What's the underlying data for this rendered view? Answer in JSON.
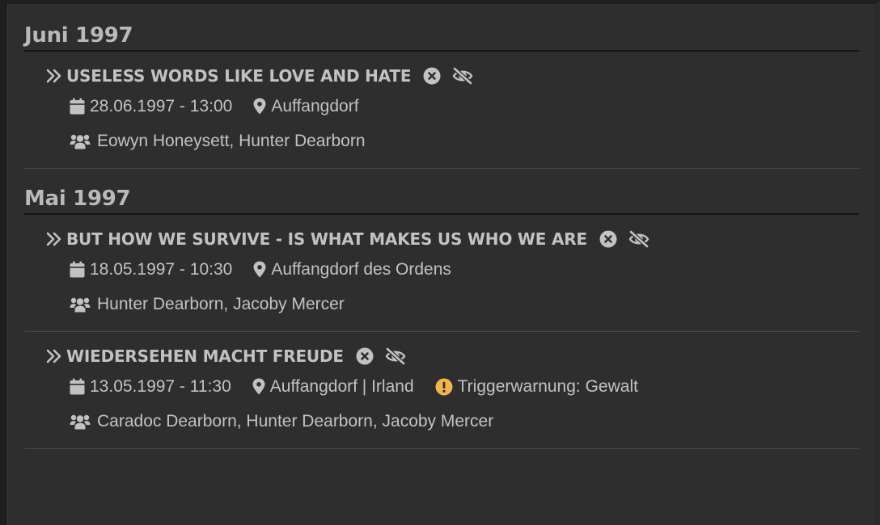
{
  "sections": [
    {
      "month": "Juni 1997",
      "events": [
        {
          "title": "USELESS WORDS LIKE LOVE AND HATE",
          "datetime": "28.06.1997 - 13:00",
          "location": "Auffangdorf",
          "participants": "Eowyn Honeysett, Hunter Dearborn"
        }
      ]
    },
    {
      "month": "Mai 1997",
      "events": [
        {
          "title": "BUT HOW WE SURVIVE - IS WHAT MAKES US WHO WE ARE",
          "datetime": "18.05.1997 - 10:30",
          "location": "Auffangdorf des Ordens",
          "participants": "Hunter Dearborn, Jacoby Mercer"
        },
        {
          "title": "WIEDERSEHEN MACHT FREUDE",
          "datetime": "13.05.1997 - 11:30",
          "location": "Auffangdorf | Irland",
          "warning": "Triggerwarnung: Gewalt",
          "participants": "Caradoc Dearborn, Hunter Dearborn, Jacoby Mercer"
        }
      ]
    }
  ],
  "icons": {
    "expand": "double-chevron-right-icon",
    "remove": "circle-x-icon",
    "hide": "eye-slash-icon",
    "date": "calendar-icon",
    "location": "map-pin-icon",
    "warning": "exclamation-circle-icon",
    "participants": "users-icon"
  },
  "colors": {
    "background": "#2e2e2e",
    "text": "#c2c2c2",
    "heading": "#b9b9b9",
    "warning": "#f2b54a"
  }
}
